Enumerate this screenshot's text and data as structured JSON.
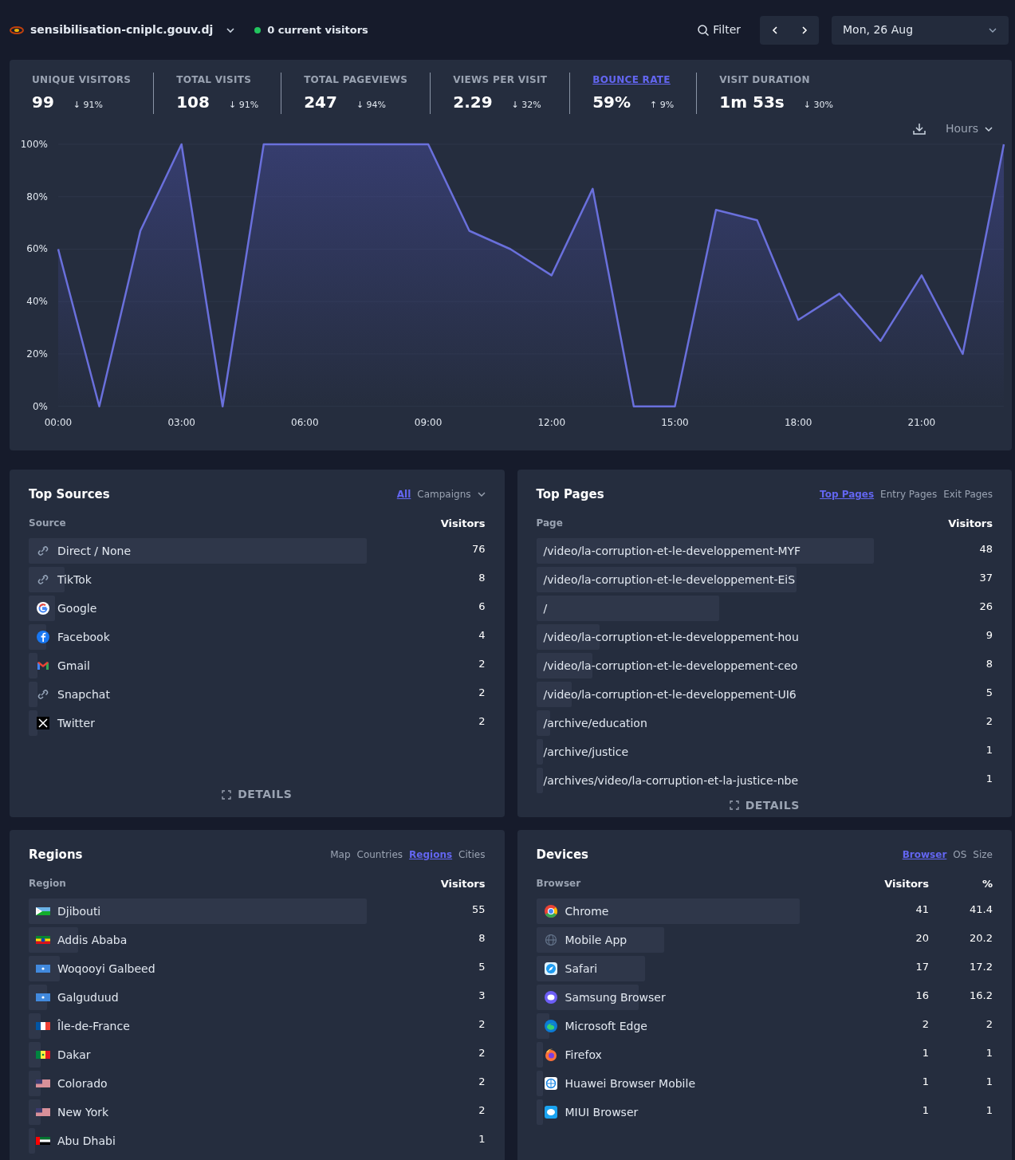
{
  "header": {
    "site": "sensibilisation-cniplc.gouv.dj",
    "live": "0 current visitors",
    "filter": "Filter",
    "date": "Mon, 26 Aug"
  },
  "stats": [
    {
      "label": "UNIQUE VISITORS",
      "value": "99",
      "change": "↓ 91%",
      "selected": false
    },
    {
      "label": "TOTAL VISITS",
      "value": "108",
      "change": "↓ 91%",
      "selected": false
    },
    {
      "label": "TOTAL PAGEVIEWS",
      "value": "247",
      "change": "↓ 94%",
      "selected": false
    },
    {
      "label": "VIEWS PER VISIT",
      "value": "2.29",
      "change": "↓ 32%",
      "selected": false
    },
    {
      "label": "BOUNCE RATE",
      "value": "59%",
      "change": "↑ 9%",
      "selected": true
    },
    {
      "label": "VISIT DURATION",
      "value": "1m 53s",
      "change": "↓ 30%",
      "selected": false
    }
  ],
  "interval": "Hours",
  "chart_data": {
    "type": "area",
    "x": [
      0,
      1,
      2,
      3,
      4,
      5,
      6,
      7,
      8,
      9,
      10,
      11,
      12,
      13,
      14,
      15,
      16,
      17,
      18,
      19,
      20,
      21,
      22,
      23
    ],
    "grid": true,
    "series": [
      {
        "color": "#6a70dc",
        "values": [
          60,
          0,
          67,
          100,
          0,
          100,
          100,
          100,
          100,
          100,
          67,
          60,
          50,
          83,
          0,
          0,
          75,
          71,
          33,
          43,
          25,
          50,
          20,
          100
        ]
      }
    ],
    "ylim": [
      0,
      100
    ],
    "xlim": [
      0,
      23
    ],
    "yticks": [
      {
        "value": 0,
        "label": "0%"
      },
      {
        "value": 20,
        "label": "20%"
      },
      {
        "value": 40,
        "label": "40%"
      },
      {
        "value": 60,
        "label": "60%"
      },
      {
        "value": 80,
        "label": "80%"
      },
      {
        "value": 100,
        "label": "100%"
      }
    ],
    "xticks": [
      {
        "value": 0,
        "label": "00:00"
      },
      {
        "value": 3,
        "label": "03:00"
      },
      {
        "value": 6,
        "label": "06:00"
      },
      {
        "value": 9,
        "label": "09:00"
      },
      {
        "value": 12,
        "label": "12:00"
      },
      {
        "value": 15,
        "label": "15:00"
      },
      {
        "value": 18,
        "label": "18:00"
      },
      {
        "value": 21,
        "label": "21:00"
      }
    ]
  },
  "panels": [
    {
      "title": "Top Sources",
      "tabs": [
        {
          "label": "All",
          "selected": true,
          "kind": "link"
        },
        {
          "label": "Campaigns",
          "selected": false,
          "kind": "dropdown"
        }
      ],
      "columns": [
        "Source",
        "Visitors"
      ],
      "details": "DETAILS",
      "rows": [
        {
          "kind": "link",
          "name": "Direct / None",
          "visitors": "76"
        },
        {
          "kind": "link",
          "name": "TikTok",
          "visitors": "8"
        },
        {
          "kind": "google",
          "name": "Google",
          "visitors": "6"
        },
        {
          "kind": "facebook",
          "name": "Facebook",
          "visitors": "4"
        },
        {
          "kind": "gmail",
          "name": "Gmail",
          "visitors": "2"
        },
        {
          "kind": "link",
          "name": "Snapchat",
          "visitors": "2"
        },
        {
          "kind": "x",
          "name": "Twitter",
          "visitors": "2"
        }
      ]
    },
    {
      "title": "Top Pages",
      "tabs": [
        {
          "label": "Top Pages",
          "selected": true
        },
        {
          "label": "Entry Pages",
          "selected": false
        },
        {
          "label": "Exit Pages",
          "selected": false
        }
      ],
      "columns": [
        "Page",
        "Visitors"
      ],
      "details": "DETAILS",
      "rows": [
        {
          "kind": "none",
          "name": "/video/la-corruption-et-le-developpement-MYF",
          "visitors": "48"
        },
        {
          "kind": "none",
          "name": "/video/la-corruption-et-le-developpement-EiS",
          "visitors": "37"
        },
        {
          "kind": "none",
          "name": "/",
          "visitors": "26"
        },
        {
          "kind": "none",
          "name": "/video/la-corruption-et-le-developpement-hou",
          "visitors": "9"
        },
        {
          "kind": "none",
          "name": "/video/la-corruption-et-le-developpement-ceo",
          "visitors": "8"
        },
        {
          "kind": "none",
          "name": "/video/la-corruption-et-le-developpement-UI6",
          "visitors": "5"
        },
        {
          "kind": "none",
          "name": "/archive/education",
          "visitors": "2"
        },
        {
          "kind": "none",
          "name": "/archive/justice",
          "visitors": "1"
        },
        {
          "kind": "none",
          "name": "/archives/video/la-corruption-et-la-justice-nbe",
          "visitors": "1"
        }
      ]
    },
    {
      "title": "Regions",
      "tabs": [
        {
          "label": "Map",
          "selected": false
        },
        {
          "label": "Countries",
          "selected": false
        },
        {
          "label": "Regions",
          "selected": true
        },
        {
          "label": "Cities",
          "selected": false
        }
      ],
      "columns": [
        "Region",
        "Visitors"
      ],
      "rows": [
        {
          "kind": "dj",
          "name": "Djibouti",
          "visitors": "55"
        },
        {
          "kind": "et",
          "name": "Addis Ababa",
          "visitors": "8"
        },
        {
          "kind": "so",
          "name": "Woqooyi Galbeed",
          "visitors": "5"
        },
        {
          "kind": "so",
          "name": "Galguduud",
          "visitors": "3"
        },
        {
          "kind": "fr",
          "name": "Île-de-France",
          "visitors": "2"
        },
        {
          "kind": "sn",
          "name": "Dakar",
          "visitors": "2"
        },
        {
          "kind": "us",
          "name": "Colorado",
          "visitors": "2"
        },
        {
          "kind": "us",
          "name": "New York",
          "visitors": "2"
        },
        {
          "kind": "ae",
          "name": "Abu Dhabi",
          "visitors": "1"
        }
      ]
    },
    {
      "title": "Devices",
      "tabs": [
        {
          "label": "Browser",
          "selected": true
        },
        {
          "label": "OS",
          "selected": false
        },
        {
          "label": "Size",
          "selected": false
        }
      ],
      "columns": [
        "Browser",
        "Visitors",
        "%"
      ],
      "rows": [
        {
          "kind": "chrome",
          "name": "Chrome",
          "visitors": "41",
          "percent": "41.4"
        },
        {
          "kind": "globe",
          "name": "Mobile App",
          "visitors": "20",
          "percent": "20.2"
        },
        {
          "kind": "safari",
          "name": "Safari",
          "visitors": "17",
          "percent": "17.2"
        },
        {
          "kind": "samsung",
          "name": "Samsung Browser",
          "visitors": "16",
          "percent": "16.2"
        },
        {
          "kind": "edge",
          "name": "Microsoft Edge",
          "visitors": "2",
          "percent": "2"
        },
        {
          "kind": "firefox",
          "name": "Firefox",
          "visitors": "1",
          "percent": "1"
        },
        {
          "kind": "huawei",
          "name": "Huawei Browser Mobile",
          "visitors": "1",
          "percent": "1"
        },
        {
          "kind": "miui",
          "name": "MIUI Browser",
          "visitors": "1",
          "percent": "1"
        }
      ]
    }
  ]
}
